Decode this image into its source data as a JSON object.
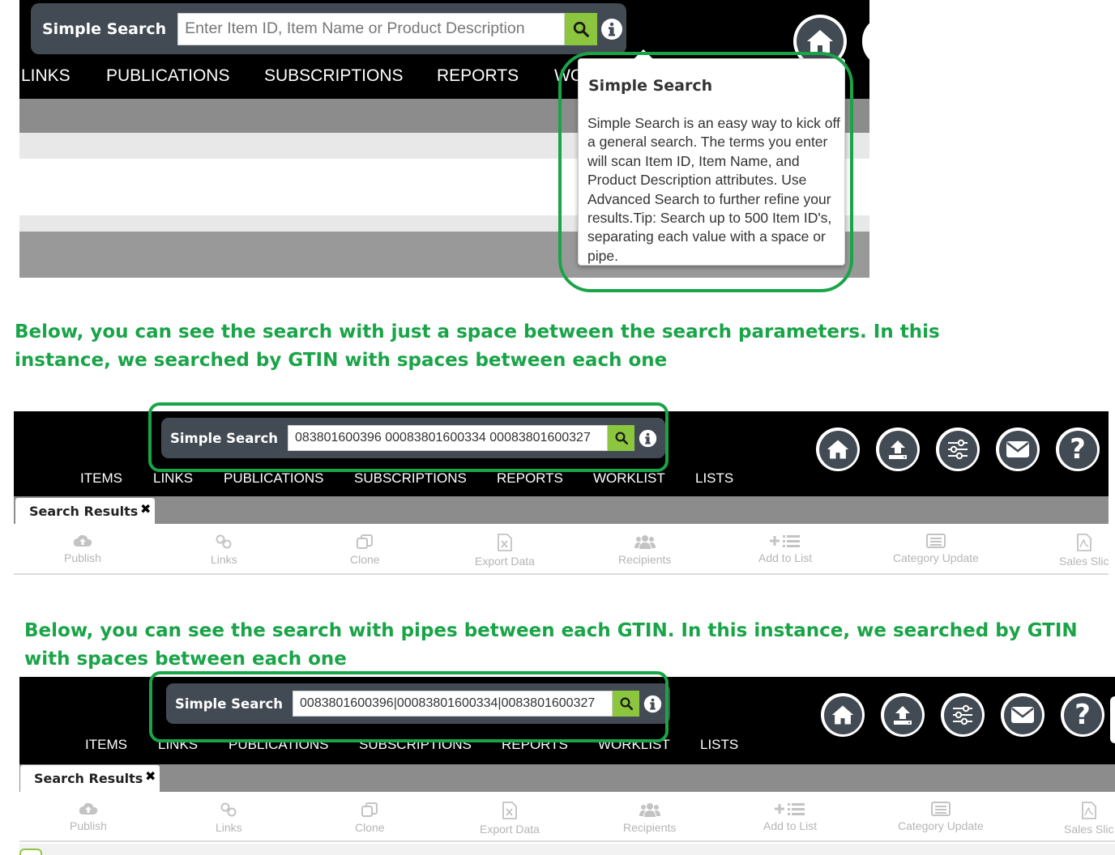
{
  "search_label": "Simple Search",
  "top": {
    "placeholder": "Enter Item ID, Item Name or Product Description",
    "nav": [
      "LINKS",
      "PUBLICATIONS",
      "SUBSCRIPTIONS",
      "REPORTS",
      "WO"
    ],
    "tooltip": {
      "title": "Simple Search",
      "body": "Simple Search is an easy way to kick off a general search. The terms you enter will scan Item ID, Item Name, and Product Description attributes. Use Advanced Search to further refine your results.Tip: Search up to 500 Item ID's, separating each value with a space or pipe."
    }
  },
  "caption1": "Below,  you can see the search with just a space between the search parameters.  In this instance, we searched by GTIN with spaces between each one",
  "caption2": "Below, you can see the search with pipes between each GTIN.  In this instance, we searched by GTIN with spaces between each one",
  "panel1": {
    "search_value": "083801600396 00083801600334 00083801600327"
  },
  "panel2": {
    "search_value": "0083801600396|00083801600334|0083801600327"
  },
  "nav_full": [
    "ITEMS",
    "LINKS",
    "PUBLICATIONS",
    "SUBSCRIPTIONS",
    "REPORTS",
    "WORKLIST",
    "LISTS"
  ],
  "header_icons": [
    "home-icon",
    "upload-icon",
    "sliders-icon",
    "mail-icon",
    "help-icon"
  ],
  "tab": {
    "label": "Search Results",
    "close": "✖"
  },
  "toolbar": {
    "publish": "Publish",
    "links": "Links",
    "clone": "Clone",
    "export": "Export Data",
    "recipients": "Recipients",
    "add_to_list": "Add to List",
    "category_update": "Category Update",
    "sales_slick": "Sales Slic"
  },
  "colors": {
    "accent_green": "#1aa448",
    "search_button": "#8cc63f",
    "search_box": "#424a53",
    "header": "#000000",
    "tabbar": "#8c8c8c"
  }
}
